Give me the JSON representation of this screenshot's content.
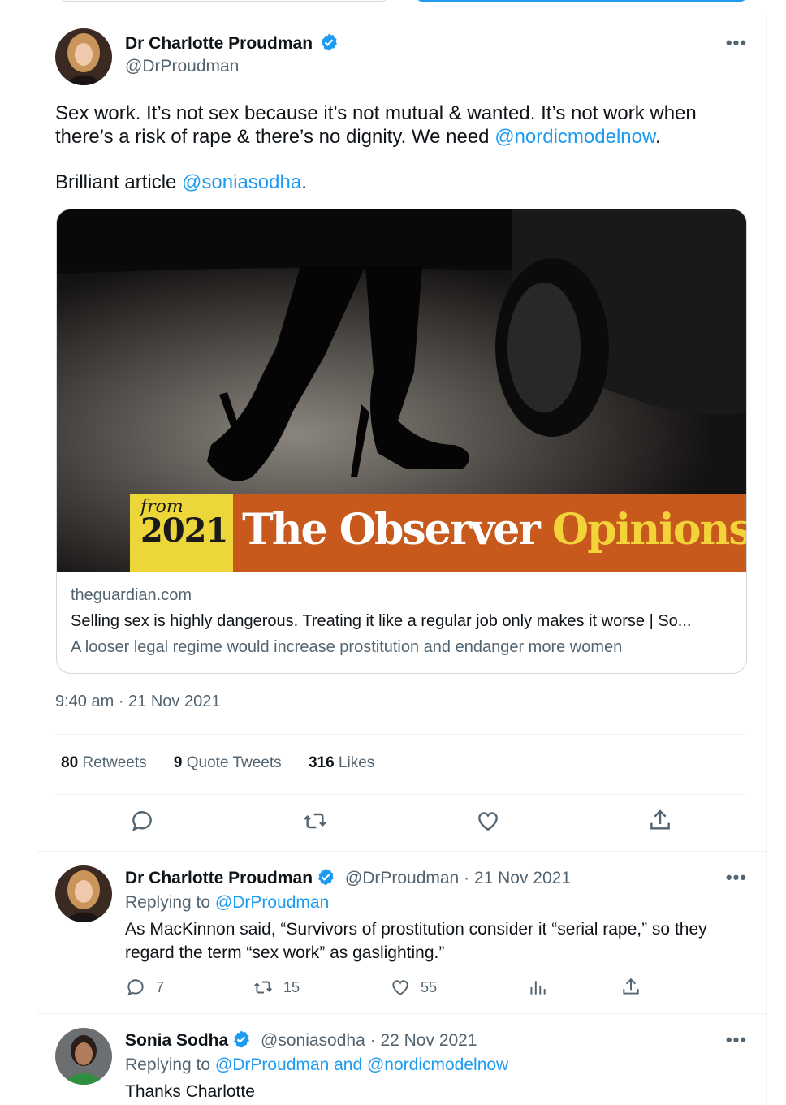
{
  "main_tweet": {
    "author_name": "Dr Charlotte Proudman",
    "author_handle": "@DrProudman",
    "text_line1_pre": "Sex work. It’s not sex because it’s not mutual & wanted. It’s not work when there’s a risk of rape & there’s no dignity. We need ",
    "mention1": "@nordicmodelnow",
    "text_line1_post": ".",
    "text_line2_pre": "Brilliant article ",
    "mention2": "@soniasodha",
    "text_line2_post": ".",
    "card": {
      "banner_from": "from",
      "banner_year": "2021",
      "banner_brand": "The Observer",
      "banner_section": "Opinions",
      "domain": "theguardian.com",
      "title": "Selling sex is highly dangerous. Treating it like a regular job only makes it worse | So...",
      "description": "A looser legal regime would increase prostitution and endanger more women"
    },
    "timestamp": "9:40 am · 21 Nov 2021",
    "stats": {
      "retweets_count": "80",
      "retweets_label": "Retweets",
      "quotes_count": "9",
      "quotes_label": "Quote Tweets",
      "likes_count": "316",
      "likes_label": "Likes"
    }
  },
  "replies": [
    {
      "author_name": "Dr Charlotte Proudman",
      "author_handle": "@DrProudman",
      "date": "· 21 Nov 2021",
      "replying_label": "Replying to ",
      "replying_to": "@DrProudman",
      "text": "As MacKinnon said, “Survivors of prostitution consider it “serial rape,” so they regard the term “sex work” as gaslighting.”",
      "reply_count": "7",
      "retweet_count": "15",
      "like_count": "55"
    },
    {
      "author_name": "Sonia Sodha",
      "author_handle": "@soniasodha",
      "date": "· 22 Nov 2021",
      "replying_label": "Replying to ",
      "replying_to": "@DrProudman and @nordicmodelnow",
      "text": "Thanks Charlotte"
    }
  ],
  "more_icon_label": "•••",
  "colors": {
    "link": "#1d9bf0",
    "muted": "#536471",
    "banner_yellow": "#ecd63a",
    "banner_orange": "#c8591c",
    "opinions_yellow": "#f2d33a"
  }
}
